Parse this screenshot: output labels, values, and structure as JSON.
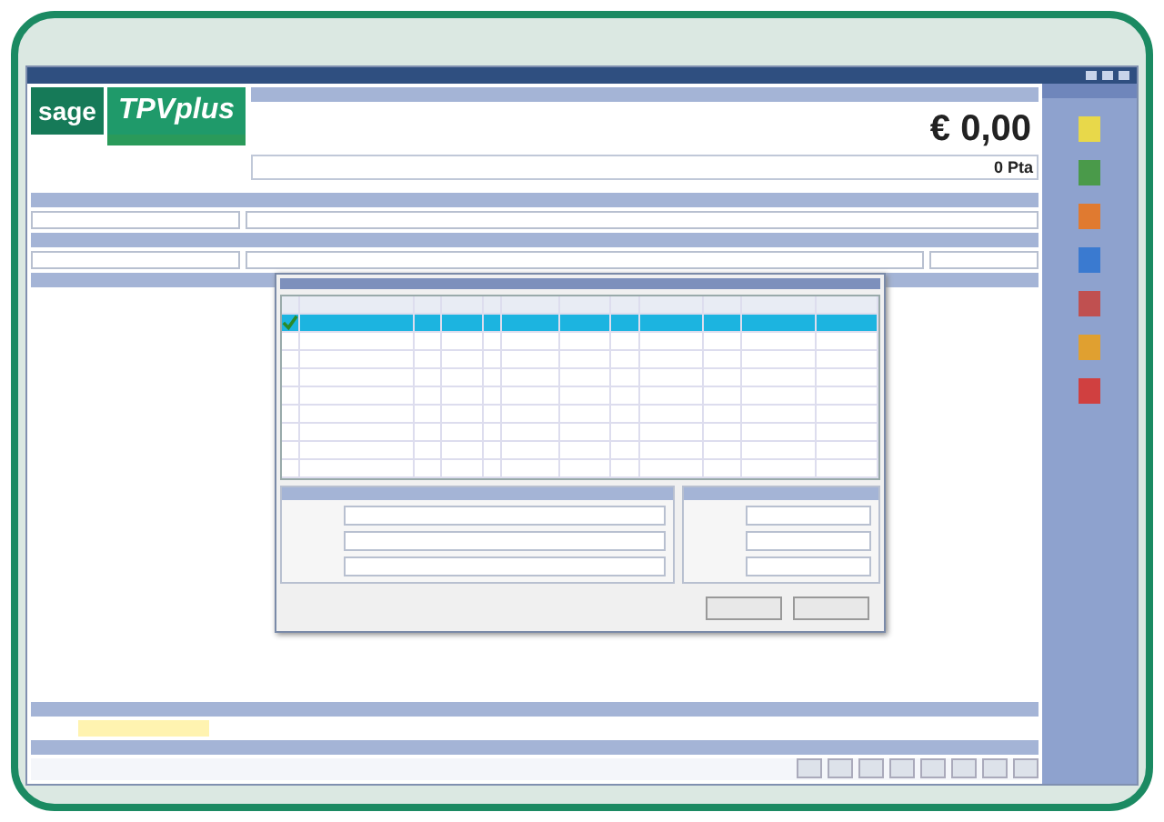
{
  "logo": {
    "brand": "sage",
    "product": "TPVplus"
  },
  "total": {
    "amount": "€ 0,00",
    "secondary": "0 Pta"
  },
  "dialog": {
    "rows": [
      {
        "selected": true,
        "checked": true
      },
      {
        "selected": false,
        "checked": false
      },
      {
        "selected": false,
        "checked": false
      },
      {
        "selected": false,
        "checked": false
      },
      {
        "selected": false,
        "checked": false
      }
    ]
  }
}
